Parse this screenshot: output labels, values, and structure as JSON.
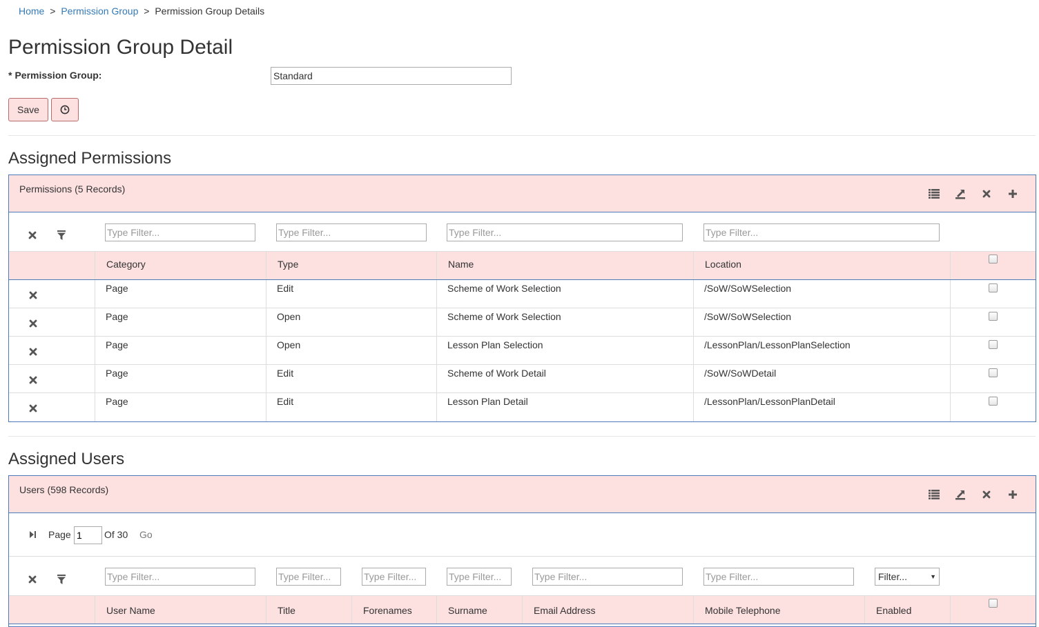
{
  "breadcrumb": {
    "home": "Home",
    "parent": "Permission Group",
    "current": "Permission Group Details",
    "sep": ">"
  },
  "page": {
    "title": "Permission Group Detail"
  },
  "form": {
    "required_mark": "*",
    "label": "Permission Group:",
    "value": "Standard"
  },
  "actions": {
    "save_label": "Save",
    "history_icon": "clock-icon"
  },
  "permissions": {
    "section_title": "Assigned Permissions",
    "panel_title": "Permissions (5 Records)",
    "filter_placeholder": "Type Filter...",
    "columns": [
      "Category",
      "Type",
      "Name",
      "Location"
    ],
    "rows": [
      {
        "category": "Page",
        "type": "Edit",
        "name": "Scheme of Work Selection",
        "location": "/SoW/SoWSelection"
      },
      {
        "category": "Page",
        "type": "Open",
        "name": "Scheme of Work Selection",
        "location": "/SoW/SoWSelection"
      },
      {
        "category": "Page",
        "type": "Open",
        "name": "Lesson Plan Selection",
        "location": "/LessonPlan/LessonPlanSelection"
      },
      {
        "category": "Page",
        "type": "Edit",
        "name": "Scheme of Work Detail",
        "location": "/SoW/SoWDetail"
      },
      {
        "category": "Page",
        "type": "Edit",
        "name": "Lesson Plan Detail",
        "location": "/LessonPlan/LessonPlanDetail"
      }
    ]
  },
  "users": {
    "section_title": "Assigned Users",
    "panel_title": "Users (598 Records)",
    "pager": {
      "page_label": "Page",
      "page_value": "1",
      "of_label": "Of 30",
      "go_label": "Go"
    },
    "filter_placeholder": "Type Filter...",
    "enabled_filter": "Filter...",
    "columns": [
      "User Name",
      "Title",
      "Forenames",
      "Surname",
      "Email Address",
      "Mobile Telephone",
      "Enabled"
    ]
  },
  "toolbar_icons": [
    "list-icon",
    "export-icon",
    "clear-icon",
    "add-icon"
  ],
  "colors": {
    "panel_bg": "#fde0e0",
    "panel_border": "#4a7ab7",
    "link": "#337ab7"
  }
}
